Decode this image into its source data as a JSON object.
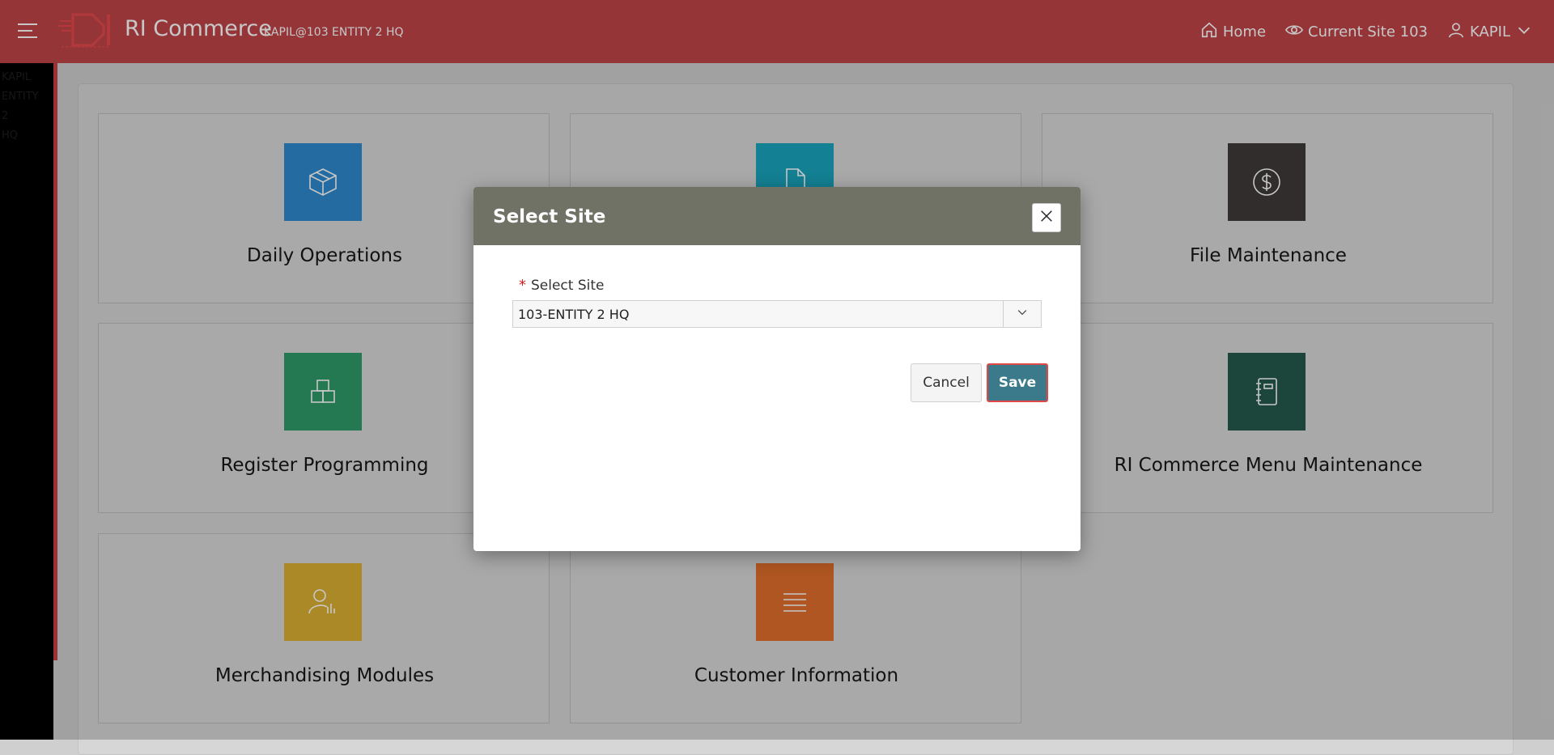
{
  "header": {
    "app_title": "RI Commerce",
    "app_subtitle": "KAPIL@103 ENTITY 2 HQ",
    "nav": [
      {
        "label": "Home",
        "icon": "home-icon"
      },
      {
        "label": "Current Site 103",
        "icon": "eye-icon"
      },
      {
        "label": "KAPIL",
        "icon": "user-icon"
      }
    ],
    "brand_color": "#bf4448"
  },
  "leftbar": {
    "lines": [
      "KAPIL",
      "ENTITY",
      "2",
      "HQ"
    ]
  },
  "cards": [
    {
      "label": "Daily Operations",
      "color": "#2f8ad0",
      "icon": "box-icon"
    },
    {
      "label": "",
      "color": "#19a5bd",
      "icon": "document-icon"
    },
    {
      "label": "File Maintenance",
      "color": "#3e3a39",
      "icon": "dollar-icon"
    },
    {
      "label": "Register Programming",
      "color": "#2f9a69",
      "icon": "blocks-icon"
    },
    {
      "label": "RI Commerce Menu Maintenance",
      "color": "#245a4e",
      "icon": "notebook-icon"
    },
    {
      "label": "Merchandising Modules",
      "color": "#ddb033",
      "icon": "user-chart-icon"
    },
    {
      "label": "Customer Information",
      "color": "#e06f2c",
      "icon": "list-icon"
    }
  ],
  "dialog": {
    "title": "Select Site",
    "field_label": "Select Site",
    "required_mark": "*",
    "select_value": "103-ENTITY 2 HQ",
    "cancel_label": "Cancel",
    "save_label": "Save",
    "header_color": "#6f7265",
    "save_color": "#3b7a8a"
  }
}
